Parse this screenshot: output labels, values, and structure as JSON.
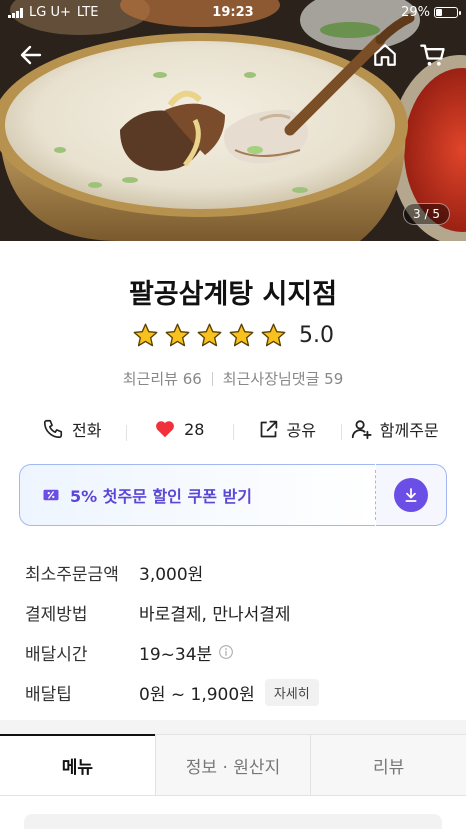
{
  "status_bar": {
    "carrier": "LG U+",
    "network": "LTE",
    "time": "19:23",
    "battery": "29%",
    "battery_level": 0.29
  },
  "hero": {
    "page_indicator": "3 / 5"
  },
  "store": {
    "name": "팔공삼계탕 시지점",
    "rating": "5.0",
    "star_count": 5,
    "recent_reviews": "최근리뷰 66",
    "owner_replies": "최근사장님댓글 59"
  },
  "actions": [
    {
      "icon": "phone-icon",
      "label": "전화"
    },
    {
      "icon": "heart-icon",
      "label": "28"
    },
    {
      "icon": "share-icon",
      "label": "공유"
    },
    {
      "icon": "person-icon",
      "label": "함께주문"
    }
  ],
  "coupon": {
    "label": "5% 첫주문 할인 쿠폰 받기"
  },
  "info": {
    "min_order_label": "최소주문금액",
    "min_order_value": "3,000원",
    "payment_label": "결제방법",
    "payment_value": "바로결제, 만나서결제",
    "delivery_time_label": "배달시간",
    "delivery_time_value": "19~34분",
    "delivery_tip_label": "배달팁",
    "delivery_tip_value": "0원 ~ 1,900원",
    "detail_button": "자세히"
  },
  "tabs": [
    {
      "label": "메뉴"
    },
    {
      "label": "정보 · 원산지"
    },
    {
      "label": "리뷰"
    }
  ],
  "colors": {
    "accent": "#6b4ee6",
    "coupon_text": "#5b46d6",
    "star": "#f7c21c",
    "heart": "#f0313c"
  }
}
